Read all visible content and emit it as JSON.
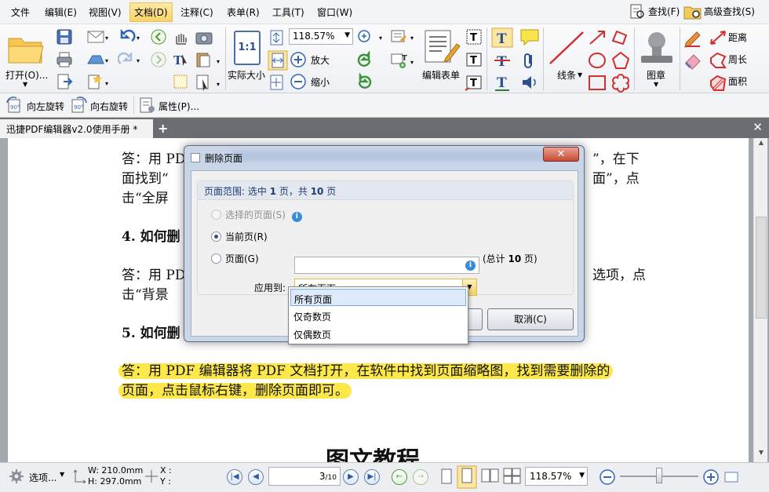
{
  "menu": {
    "items": [
      "文件",
      "编辑(E)",
      "视图(V)",
      "文档(D)",
      "注释(C)",
      "表单(R)",
      "工具(T)",
      "窗口(W)"
    ],
    "active_index": 3,
    "find": "查找(F)",
    "advanced_find": "高级查找(S)"
  },
  "ribbon": {
    "open": "打开(O)...",
    "zoom": "118.57%",
    "zoom_in": "放大",
    "zoom_out": "缩小",
    "actual_size": "实际大小",
    "actual_size_icon": "1:1",
    "edit_form": "编辑表单",
    "lines": "线条",
    "stamp": "图章",
    "distance": "距离",
    "perimeter": "周长",
    "area": "面积"
  },
  "quickbar": {
    "rotate_left": "向左旋转",
    "rotate_right": "向右旋转",
    "properties": "属性(P)..."
  },
  "tabs": {
    "doc_title": "迅捷PDF编辑器v2.0使用手册 *",
    "add": "+",
    "close": "✕"
  },
  "document": {
    "lines": [
      "答：用 PDF",
      "”，在下",
      "面找到“",
      "面”，点",
      "击“全屏",
      "4. 如何删",
      "答：用 PD",
      "选项，点",
      "击“背景",
      "5. 如何删",
      "答：用 PDF 编辑器将 PDF 文档打开，在软件中找到页面缩略图，找到需要删除的",
      "页面，点击鼠标右键，删除页面即可。"
    ],
    "section_title": "图文教程"
  },
  "dialog": {
    "title": "删除页面",
    "close": "✕",
    "range_prefix": "页面范围: 选中 ",
    "range_selected": "1",
    "range_mid": " 页，共 ",
    "range_total": "10",
    "range_suffix": " 页",
    "opt_selected_pages": "选择的页面(S)",
    "opt_current_page": "当前页(R)",
    "opt_pages": "页面(G)",
    "total_prefix": "(总计 ",
    "total_count": "10",
    "total_suffix": " 页)",
    "apply_to_label": "应用到:",
    "apply_to_value": "所有页面",
    "cancel": "取消(C)",
    "dropdown_options": [
      "所有页面",
      "仅奇数页",
      "仅偶数页"
    ]
  },
  "status": {
    "options": "选项...",
    "width": "W: 210.0mm",
    "height": "H: 297.0mm",
    "x": "X :",
    "y": "Y :",
    "page": "3",
    "page_total": "/10",
    "zoom": "118.57%"
  },
  "colors": {
    "highlight": "#fde84a",
    "accent_menu": "#f8d46a",
    "tab_bar": "#6a6d72",
    "dialog_frame": "#c9d6e8",
    "red_close": "#c74c36"
  }
}
